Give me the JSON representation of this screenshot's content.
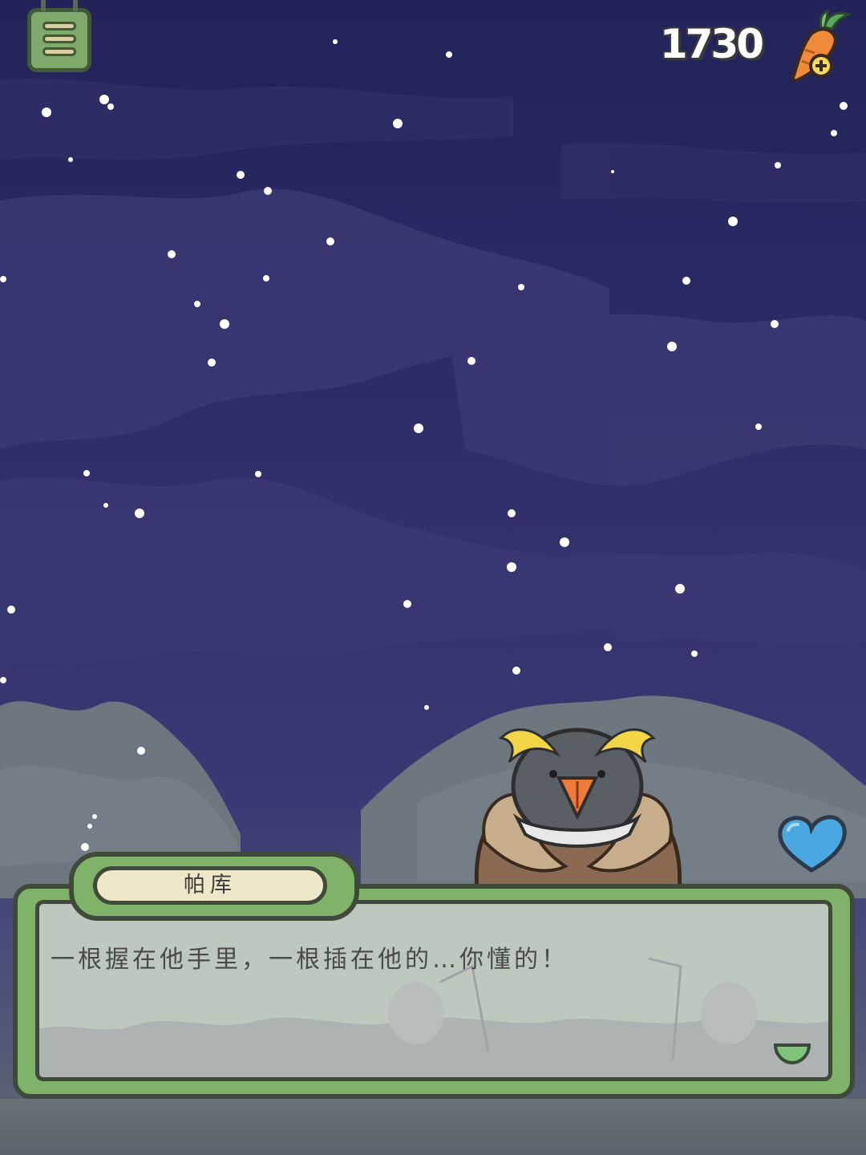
{
  "hud": {
    "carrot_count": "1730",
    "menu_icon": "menu-icon",
    "currency_icon": "carrot-plus-icon"
  },
  "scene": {
    "time_of_day": "night",
    "weather": "snow",
    "character_icon": "rockhopper-penguin",
    "affection_icon": "heart-icon",
    "colors": {
      "sky": "#2b2b66",
      "panel_green": "#7fb36a",
      "heart_blue": "#4aa7e0"
    }
  },
  "dialog": {
    "speaker": "帕库",
    "text": "一根握在他手里，一根插在他的…你懂的！",
    "next_icon": "next-arrow-icon"
  }
}
